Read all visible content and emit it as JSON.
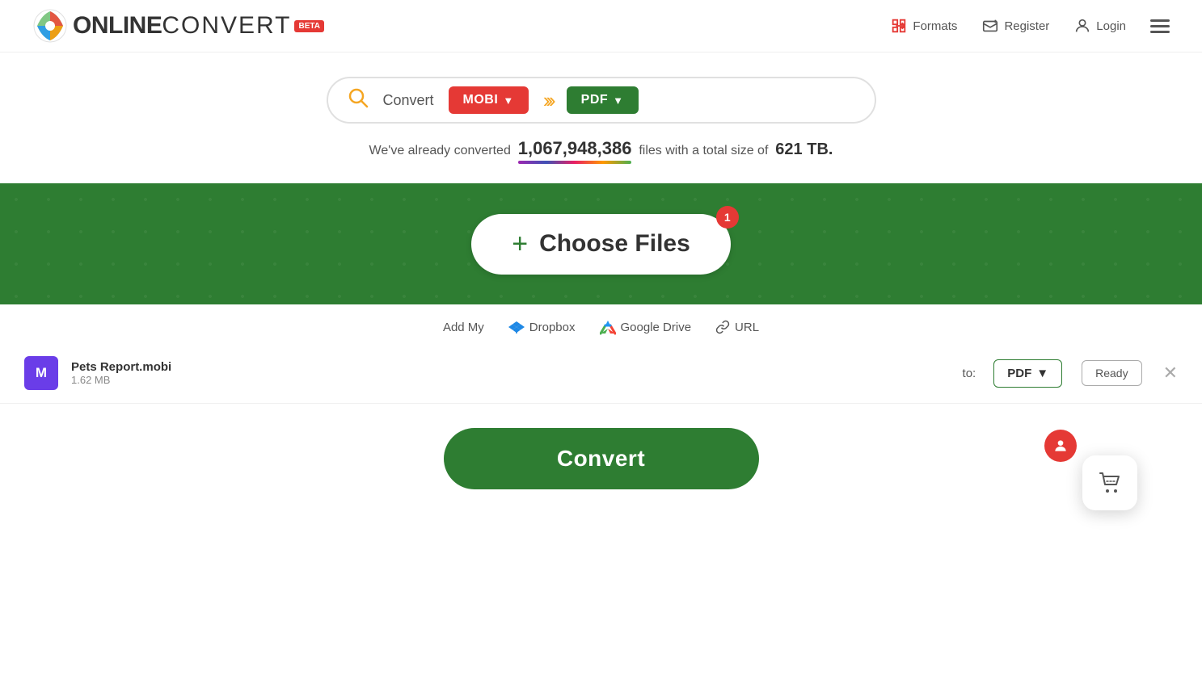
{
  "header": {
    "logo": "ONLINECONVERT",
    "logo_online": "ONLINE",
    "logo_convert": "CONVERT",
    "nav": {
      "formats_label": "Formats",
      "register_label": "Register",
      "login_label": "Login"
    }
  },
  "converter": {
    "convert_label": "Convert",
    "from_format": "MOBI",
    "to_format": "PDF",
    "arrows": "›››"
  },
  "stats": {
    "prefix": "We've already converted",
    "number": "1,067,948,386",
    "middle": "files with a total size of",
    "size": "621 TB."
  },
  "upload": {
    "choose_files_label": "Choose Files",
    "badge_count": "1",
    "add_my_label": "Add My",
    "dropbox_label": "Dropbox",
    "google_drive_label": "Google Drive",
    "url_label": "URL"
  },
  "file_item": {
    "avatar_letter": "M",
    "file_name": "Pets Report.mobi",
    "file_size": "1.62 MB",
    "to_label": "to:",
    "format": "PDF",
    "status": "Ready",
    "close_aria": "Remove file"
  },
  "actions": {
    "convert_label": "Convert"
  },
  "floating": {
    "cart_icon": "🛒",
    "user_icon": "👤"
  }
}
